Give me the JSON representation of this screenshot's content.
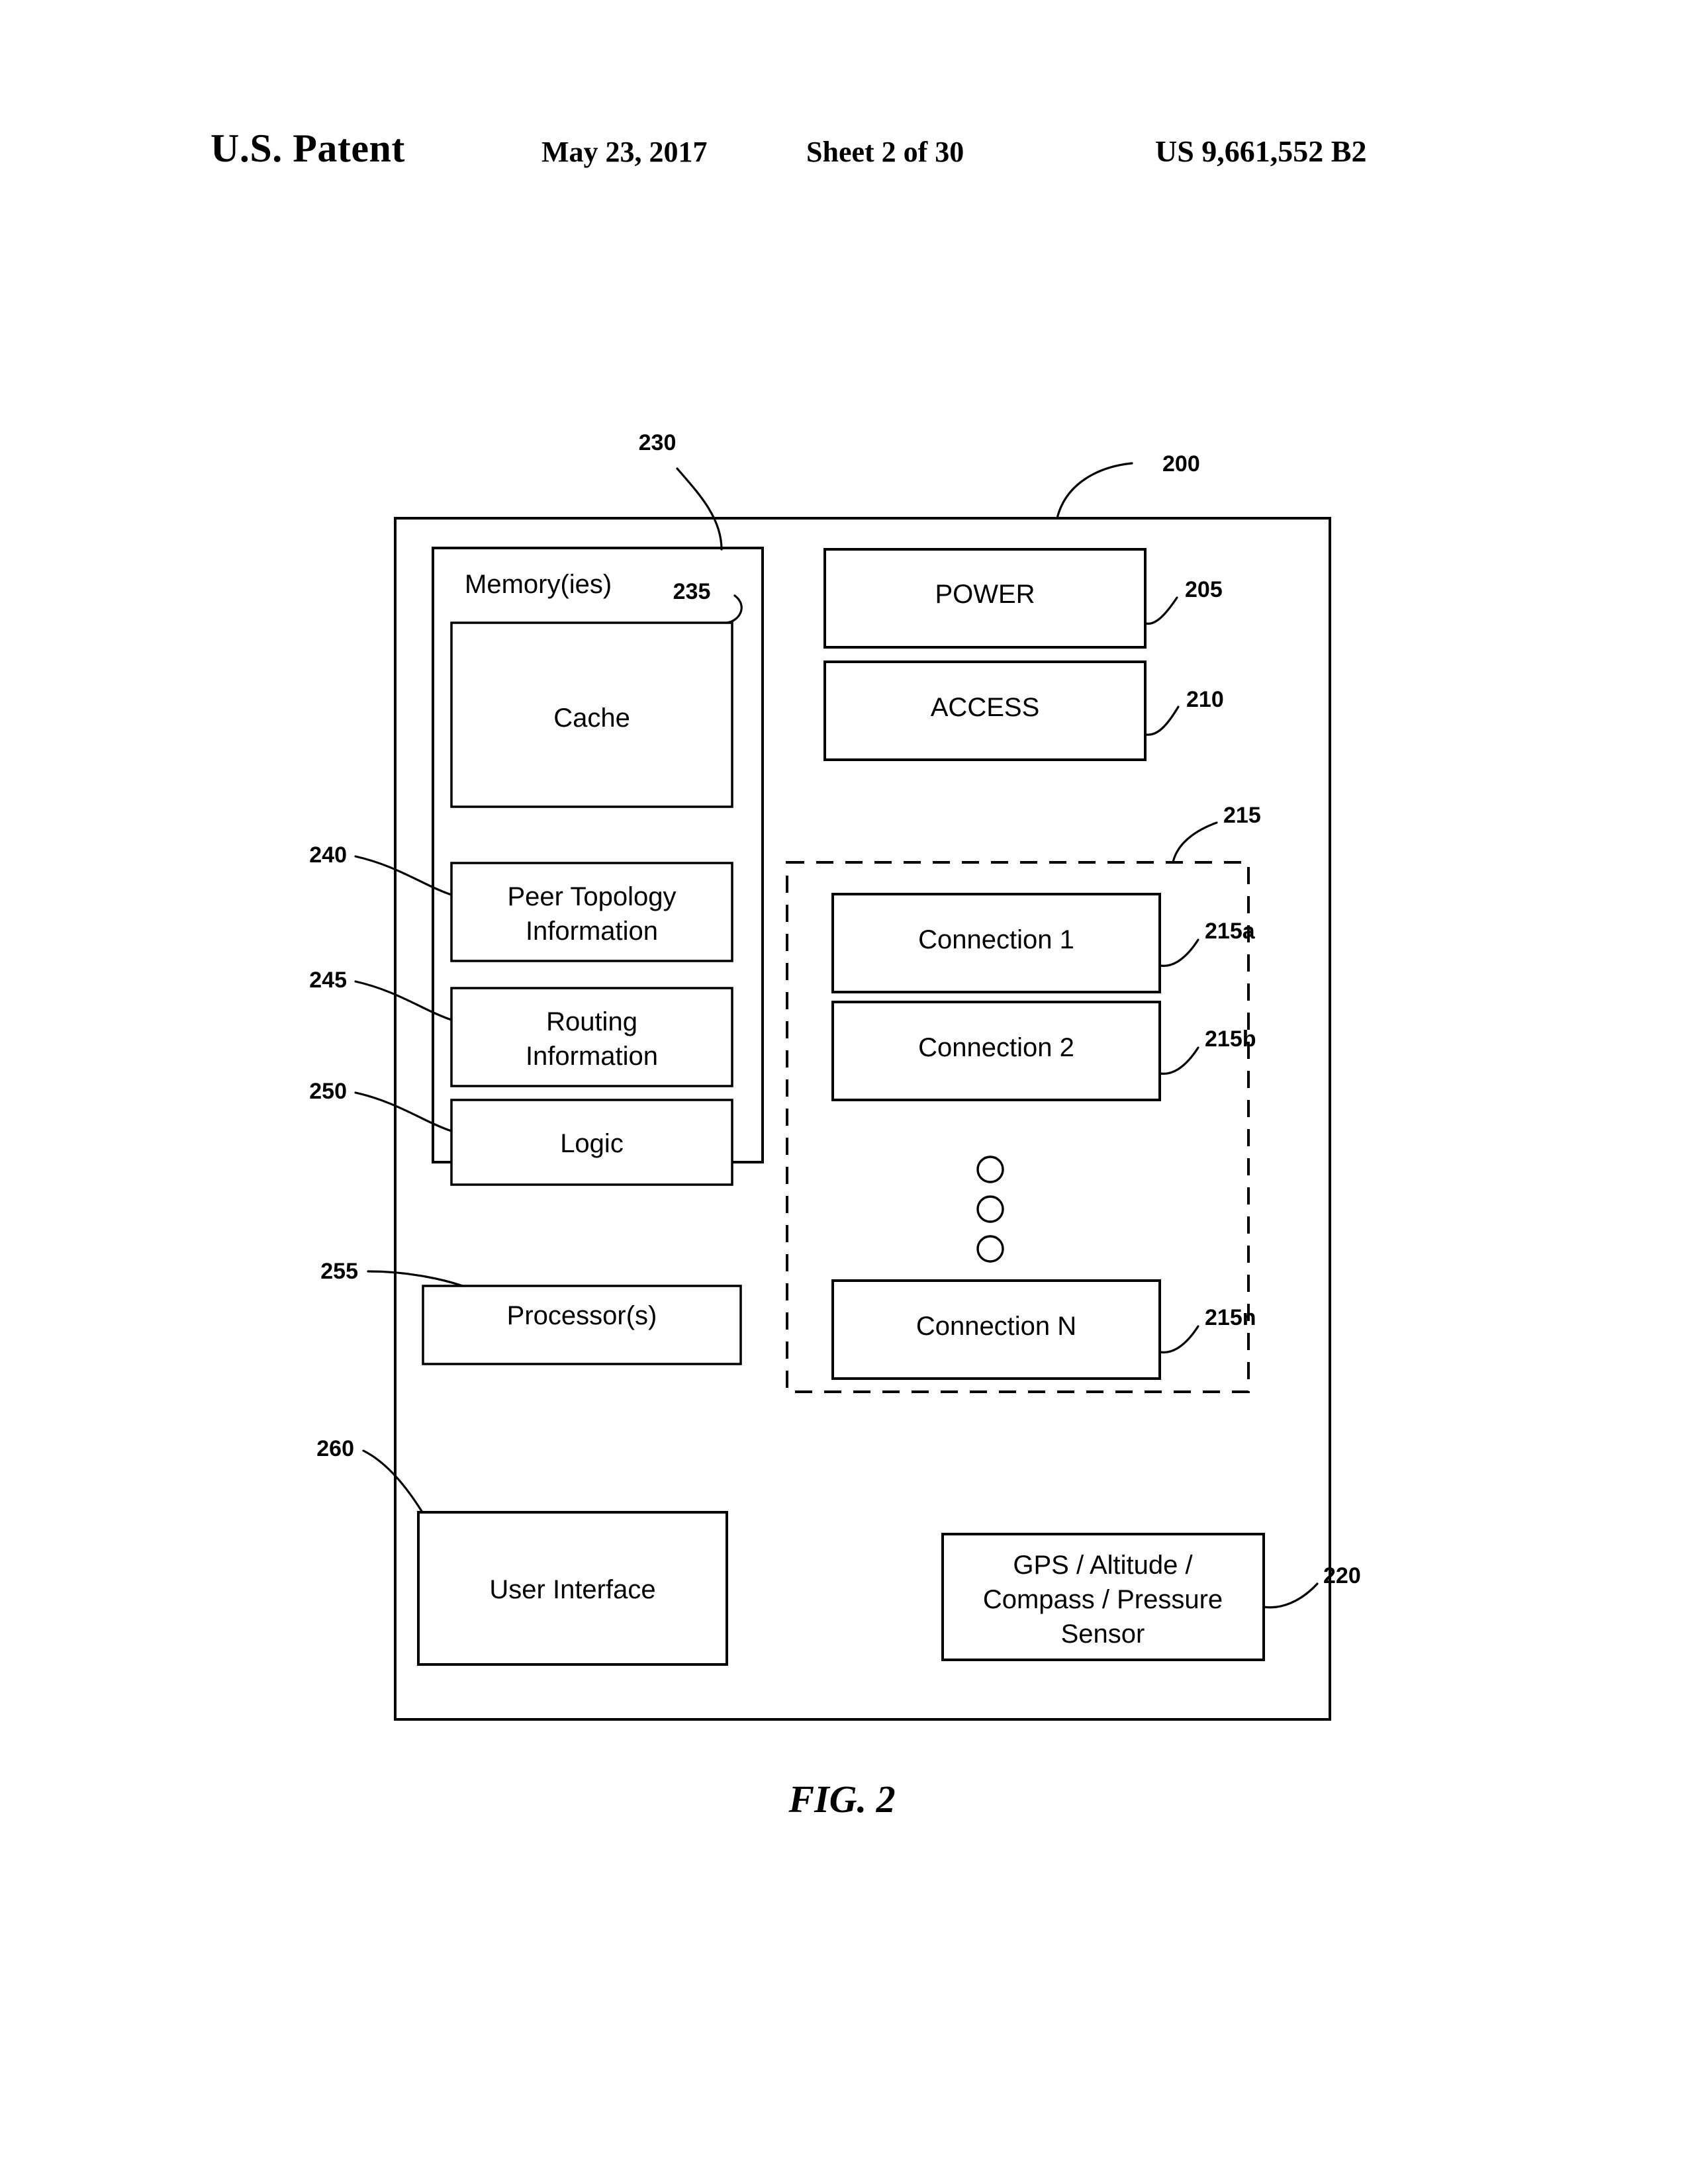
{
  "header": {
    "office": "U.S. Patent",
    "date": "May 23, 2017",
    "sheet": "Sheet 2 of 30",
    "patent_number": "US 9,661,552 B2"
  },
  "figure": {
    "caption": "FIG. 2",
    "device_ref": "200"
  },
  "blocks": {
    "memory": {
      "label": "Memory(ies)",
      "ref": "230"
    },
    "cache": {
      "label": "Cache",
      "ref": "235"
    },
    "peer_topology": {
      "label_line1": "Peer Topology",
      "label_line2": "Information",
      "ref": "240"
    },
    "routing": {
      "label_line1": "Routing",
      "label_line2": "Information",
      "ref": "245"
    },
    "logic": {
      "label": "Logic",
      "ref": "250"
    },
    "processor": {
      "label": "Processor(s)",
      "ref": "255"
    },
    "user_interface": {
      "label": "User Interface",
      "ref": "260"
    },
    "power": {
      "label": "POWER",
      "ref": "205"
    },
    "access": {
      "label": "ACCESS",
      "ref": "210"
    },
    "connections_group": {
      "ref": "215"
    },
    "connection_1": {
      "label": "Connection 1",
      "ref": "215a"
    },
    "connection_2": {
      "label": "Connection 2",
      "ref": "215b"
    },
    "connection_n": {
      "label": "Connection N",
      "ref": "215n"
    },
    "sensor": {
      "label_line1": "GPS / Altitude /",
      "label_line2": "Compass / Pressure",
      "label_line3": "Sensor",
      "ref": "220"
    }
  },
  "colors": {
    "ink": "#000000",
    "paper": "#ffffff"
  }
}
